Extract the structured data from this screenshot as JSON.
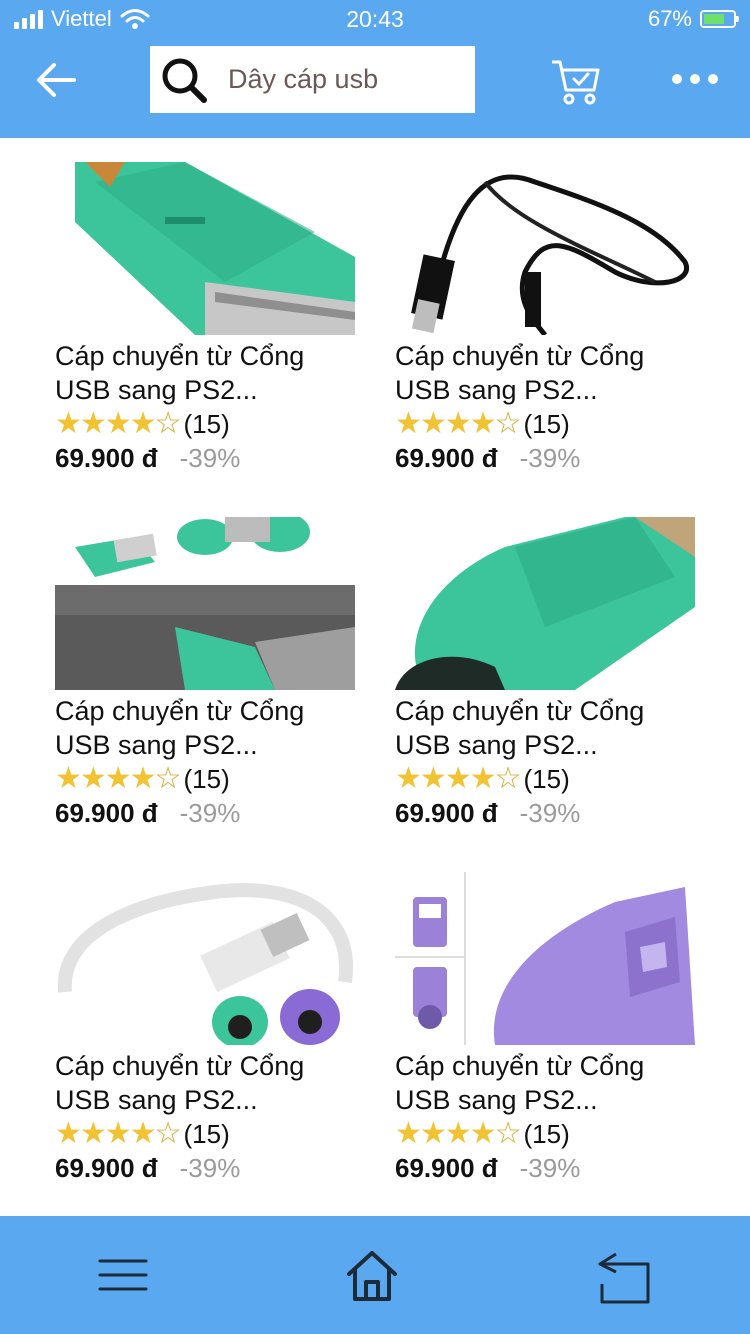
{
  "status_bar": {
    "carrier": "Viettel",
    "time": "20:43",
    "battery": "67%"
  },
  "header": {
    "search_value": "Dây cáp usb",
    "icons": [
      "back-arrow-icon",
      "search-icon",
      "cart-icon",
      "more-icon"
    ]
  },
  "products": [
    {
      "title_line1": "Cáp chuyển từ Cổng",
      "title_line2": "USB sang PS2...",
      "reviews": "(15)",
      "rating": 4,
      "price": "69.900 đ",
      "discount": "-39%"
    },
    {
      "title_line1": "Cáp chuyển từ Cổng",
      "title_line2": "USB sang PS2...",
      "reviews": "(15)",
      "rating": 4,
      "price": "69.900 đ",
      "discount": "-39%"
    },
    {
      "title_line1": "Cáp chuyển từ Cổng",
      "title_line2": "USB sang PS2...",
      "reviews": "(15)",
      "rating": 4,
      "price": "69.900 đ",
      "discount": "-39%"
    },
    {
      "title_line1": "Cáp chuyển từ Cổng",
      "title_line2": "USB sang PS2...",
      "reviews": "(15)",
      "rating": 4,
      "price": "69.900 đ",
      "discount": "-39%"
    },
    {
      "title_line1": "Cáp chuyển từ Cổng",
      "title_line2": "USB sang PS2...",
      "reviews": "(15)",
      "rating": 4,
      "price": "69.900 đ",
      "discount": "-39%"
    },
    {
      "title_line1": "Cáp chuyển từ Cổng",
      "title_line2": "USB sang PS2...",
      "reviews": "(15)",
      "rating": 4,
      "price": "69.900 đ",
      "discount": "-39%"
    }
  ],
  "bottom_bar": {
    "icons": [
      "menu-icon",
      "home-icon",
      "back-navigation-icon"
    ]
  },
  "colors": {
    "accent": "#5aa9f0",
    "star": "#f1c232",
    "discount": "#9a9a9a"
  }
}
